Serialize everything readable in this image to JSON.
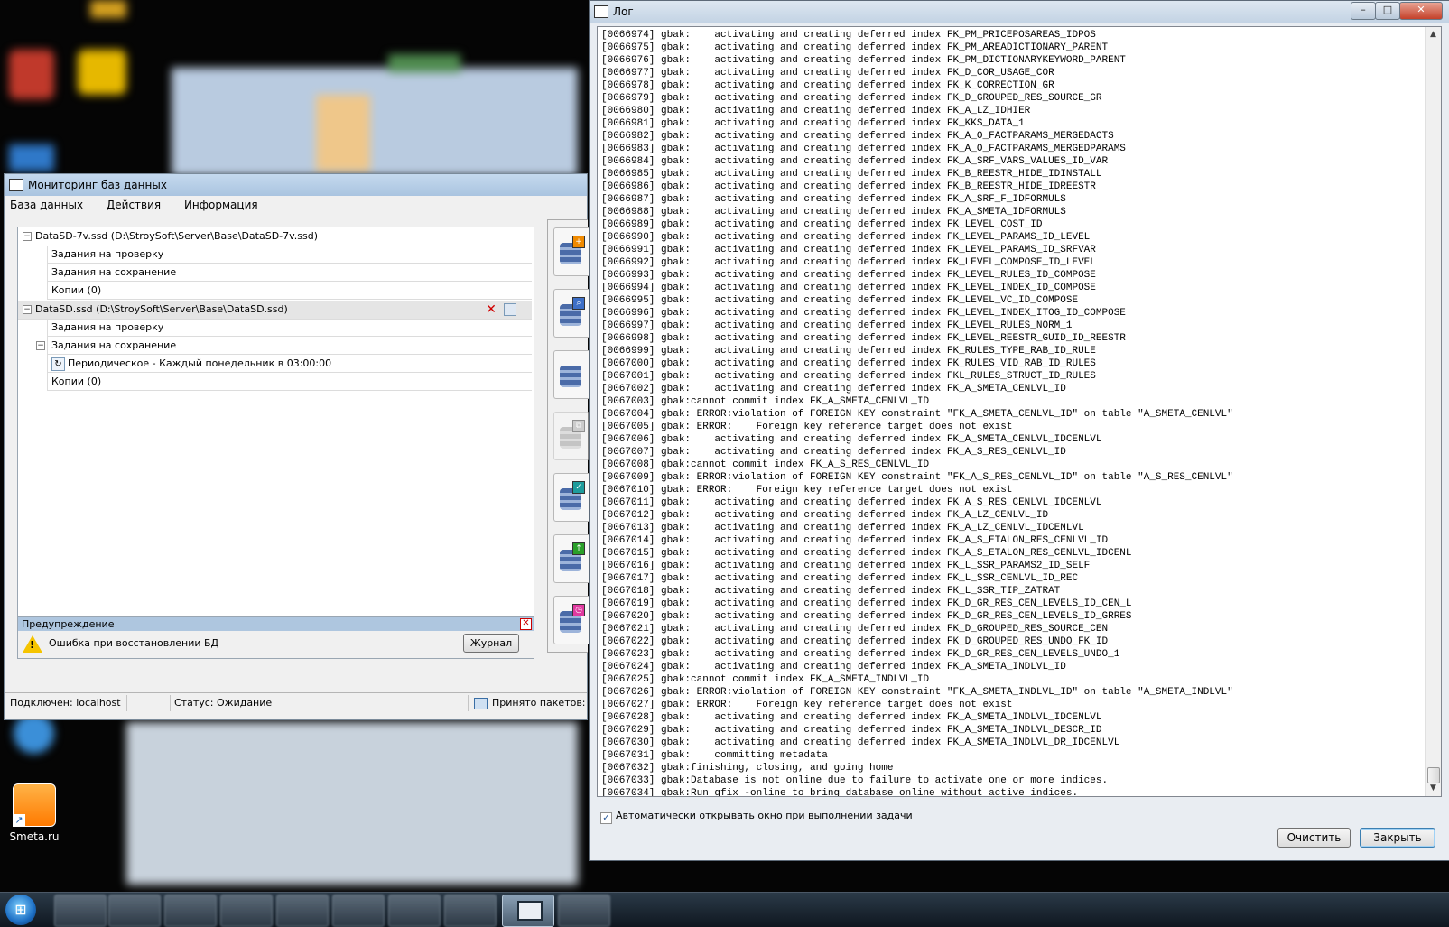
{
  "desktop": {
    "icons": [
      {
        "label": "Smeta.ru"
      }
    ]
  },
  "monitor_window": {
    "title": "Мониторинг баз данных",
    "menu": [
      "База данных",
      "Действия",
      "Информация"
    ],
    "databases": [
      {
        "label": "DataSD-7v.ssd (D:\\StroySoft\\Server\\Base\\DataSD-7v.ssd)",
        "children": [
          "Задания на проверку",
          "Задания на сохранение",
          "Копии (0)"
        ]
      },
      {
        "label": "DataSD.ssd (D:\\StroySoft\\Server\\Base\\DataSD.ssd)",
        "children": [
          "Задания на проверку",
          "Задания на сохранение",
          "Периодическое - Каждый понедельник в 03:00:00",
          "Копии (0)"
        ]
      }
    ],
    "warning": {
      "header": "Предупреждение",
      "message": "Ошибка при восстановлении БД",
      "button": "Журнал"
    },
    "status": {
      "connected": "Подключен: localhost",
      "state": "Статус: Ожидание",
      "packets": "Принято пакетов:"
    },
    "colors": {
      "header_blue": "#aec6df",
      "delete_red": "#d00000"
    }
  },
  "log_window": {
    "title": "Лог",
    "lines": [
      "[0066974] gbak:    activating and creating deferred index FK_PM_PRICEPOSAREAS_IDPOS",
      "[0066975] gbak:    activating and creating deferred index FK_PM_AREADICTIONARY_PARENT",
      "[0066976] gbak:    activating and creating deferred index FK_PM_DICTIONARYKEYWORD_PARENT",
      "[0066977] gbak:    activating and creating deferred index FK_D_COR_USAGE_COR",
      "[0066978] gbak:    activating and creating deferred index FK_K_CORRECTION_GR",
      "[0066979] gbak:    activating and creating deferred index FK_D_GROUPED_RES_SOURCE_GR",
      "[0066980] gbak:    activating and creating deferred index FK_A_LZ_IDHIER",
      "[0066981] gbak:    activating and creating deferred index FK_KKS_DATA_1",
      "[0066982] gbak:    activating and creating deferred index FK_A_O_FACTPARAMS_MERGEDACTS",
      "[0066983] gbak:    activating and creating deferred index FK_A_O_FACTPARAMS_MERGEDPARAMS",
      "[0066984] gbak:    activating and creating deferred index FK_A_SRF_VARS_VALUES_ID_VAR",
      "[0066985] gbak:    activating and creating deferred index FK_B_REESTR_HIDE_IDINSTALL",
      "[0066986] gbak:    activating and creating deferred index FK_B_REESTR_HIDE_IDREESTR",
      "[0066987] gbak:    activating and creating deferred index FK_A_SRF_F_IDFORMULS",
      "[0066988] gbak:    activating and creating deferred index FK_A_SMETA_IDFORMULS",
      "[0066989] gbak:    activating and creating deferred index FK_LEVEL_COST_ID",
      "[0066990] gbak:    activating and creating deferred index FK_LEVEL_PARAMS_ID_LEVEL",
      "[0066991] gbak:    activating and creating deferred index FK_LEVEL_PARAMS_ID_SRFVAR",
      "[0066992] gbak:    activating and creating deferred index FK_LEVEL_COMPOSE_ID_LEVEL",
      "[0066993] gbak:    activating and creating deferred index FK_LEVEL_RULES_ID_COMPOSE",
      "[0066994] gbak:    activating and creating deferred index FK_LEVEL_INDEX_ID_COMPOSE",
      "[0066995] gbak:    activating and creating deferred index FK_LEVEL_VC_ID_COMPOSE",
      "[0066996] gbak:    activating and creating deferred index FK_LEVEL_INDEX_ITOG_ID_COMPOSE",
      "[0066997] gbak:    activating and creating deferred index FK_LEVEL_RULES_NORM_1",
      "[0066998] gbak:    activating and creating deferred index FK_LEVEL_REESTR_GUID_ID_REESTR",
      "[0066999] gbak:    activating and creating deferred index FK_RULES_TYPE_RAB_ID_RULE",
      "[0067000] gbak:    activating and creating deferred index FK_RULES_VID_RAB_ID_RULES",
      "[0067001] gbak:    activating and creating deferred index FKL_RULES_STRUCT_ID_RULES",
      "[0067002] gbak:    activating and creating deferred index FK_A_SMETA_CENLVL_ID",
      "[0067003] gbak:cannot commit index FK_A_SMETA_CENLVL_ID",
      "[0067004] gbak: ERROR:violation of FOREIGN KEY constraint \"FK_A_SMETA_CENLVL_ID\" on table \"A_SMETA_CENLVL\"",
      "[0067005] gbak: ERROR:    Foreign key reference target does not exist",
      "[0067006] gbak:    activating and creating deferred index FK_A_SMETA_CENLVL_IDCENLVL",
      "[0067007] gbak:    activating and creating deferred index FK_A_S_RES_CENLVL_ID",
      "[0067008] gbak:cannot commit index FK_A_S_RES_CENLVL_ID",
      "[0067009] gbak: ERROR:violation of FOREIGN KEY constraint \"FK_A_S_RES_CENLVL_ID\" on table \"A_S_RES_CENLVL\"",
      "[0067010] gbak: ERROR:    Foreign key reference target does not exist",
      "[0067011] gbak:    activating and creating deferred index FK_A_S_RES_CENLVL_IDCENLVL",
      "[0067012] gbak:    activating and creating deferred index FK_A_LZ_CENLVL_ID",
      "[0067013] gbak:    activating and creating deferred index FK_A_LZ_CENLVL_IDCENLVL",
      "[0067014] gbak:    activating and creating deferred index FK_A_S_ETALON_RES_CENLVL_ID",
      "[0067015] gbak:    activating and creating deferred index FK_A_S_ETALON_RES_CENLVL_IDCENL",
      "[0067016] gbak:    activating and creating deferred index FK_L_SSR_PARAMS2_ID_SELF",
      "[0067017] gbak:    activating and creating deferred index FK_L_SSR_CENLVL_ID_REC",
      "[0067018] gbak:    activating and creating deferred index FK_L_SSR_TIP_ZATRAT",
      "[0067019] gbak:    activating and creating deferred index FK_D_GR_RES_CEN_LEVELS_ID_CEN_L",
      "[0067020] gbak:    activating and creating deferred index FK_D_GR_RES_CEN_LEVELS_ID_GRRES",
      "[0067021] gbak:    activating and creating deferred index FK_D_GROUPED_RES_SOURCE_CEN",
      "[0067022] gbak:    activating and creating deferred index FK_D_GROUPED_RES_UNDO_FK_ID",
      "[0067023] gbak:    activating and creating deferred index FK_D_GR_RES_CEN_LEVELS_UNDO_1",
      "[0067024] gbak:    activating and creating deferred index FK_A_SMETA_INDLVL_ID",
      "[0067025] gbak:cannot commit index FK_A_SMETA_INDLVL_ID",
      "[0067026] gbak: ERROR:violation of FOREIGN KEY constraint \"FK_A_SMETA_INDLVL_ID\" on table \"A_SMETA_INDLVL\"",
      "[0067027] gbak: ERROR:    Foreign key reference target does not exist",
      "[0067028] gbak:    activating and creating deferred index FK_A_SMETA_INDLVL_IDCENLVL",
      "[0067029] gbak:    activating and creating deferred index FK_A_SMETA_INDLVL_DESCR_ID",
      "[0067030] gbak:    activating and creating deferred index FK_A_SMETA_INDLVL_DR_IDCENLVL",
      "[0067031] gbak:    committing metadata",
      "[0067032] gbak:finishing, closing, and going home",
      "[0067033] gbak:Database is not online due to failure to activate one or more indices.",
      "[0067034] gbak:Run gfix -online to bring database online without active indices."
    ],
    "auto_open_label": "Автоматически открывать окно при  выполнении задачи",
    "auto_open_checked": true,
    "buttons": {
      "clear": "Очистить",
      "close": "Закрыть"
    }
  }
}
